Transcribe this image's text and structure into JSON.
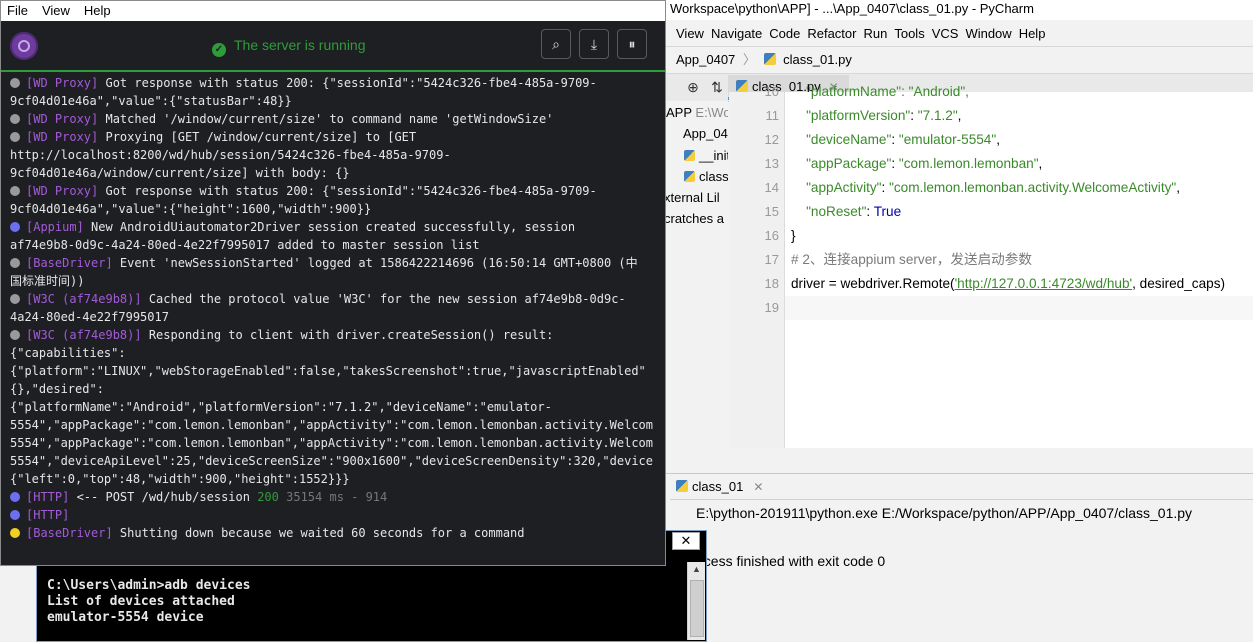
{
  "pycharm": {
    "title": "Workspace\\python\\APP] - ...\\App_0407\\class_01.py - PyCharm",
    "menu": [
      "View",
      "Navigate",
      "Code",
      "Refactor",
      "Run",
      "Tools",
      "VCS",
      "Window",
      "Help"
    ],
    "breadcrumb": [
      "App_0407",
      "class_01.py"
    ],
    "editor_tab": "class_01.py",
    "tree": [
      {
        "label": "APP",
        "extra": "E:\\Wo"
      },
      {
        "label": "App_04"
      },
      {
        "label": "__init"
      },
      {
        "label": "class"
      },
      {
        "label": "xternal Lil"
      },
      {
        "label": "cratches a"
      }
    ],
    "code_lines": [
      {
        "n": "10",
        "parts": [
          {
            "t": "    \"platformName\": \"Android\",",
            "c": "str"
          }
        ]
      },
      {
        "n": "11",
        "parts": [
          {
            "t": "    ",
            "c": ""
          },
          {
            "t": "\"platformVersion\"",
            "c": "str"
          },
          {
            "t": ": ",
            "c": ""
          },
          {
            "t": "\"7.1.2\"",
            "c": "str"
          },
          {
            "t": ",",
            "c": ""
          }
        ]
      },
      {
        "n": "12",
        "parts": [
          {
            "t": "    ",
            "c": ""
          },
          {
            "t": "\"deviceName\"",
            "c": "str"
          },
          {
            "t": ": ",
            "c": ""
          },
          {
            "t": "\"emulator-5554\"",
            "c": "str"
          },
          {
            "t": ",",
            "c": ""
          }
        ]
      },
      {
        "n": "13",
        "parts": [
          {
            "t": "    ",
            "c": ""
          },
          {
            "t": "\"appPackage\"",
            "c": "str"
          },
          {
            "t": ": ",
            "c": ""
          },
          {
            "t": "\"com.lemon.lemonban\"",
            "c": "str"
          },
          {
            "t": ",",
            "c": ""
          }
        ]
      },
      {
        "n": "14",
        "parts": [
          {
            "t": "    ",
            "c": ""
          },
          {
            "t": "\"appActivity\"",
            "c": "str"
          },
          {
            "t": ": ",
            "c": ""
          },
          {
            "t": "\"com.lemon.lemonban.activity.WelcomeActivity\"",
            "c": "str"
          },
          {
            "t": ",",
            "c": ""
          }
        ]
      },
      {
        "n": "15",
        "parts": [
          {
            "t": "    ",
            "c": ""
          },
          {
            "t": "\"noReset\"",
            "c": "str"
          },
          {
            "t": ": ",
            "c": ""
          },
          {
            "t": "True",
            "c": "kw"
          }
        ]
      },
      {
        "n": "16",
        "parts": [
          {
            "t": "}",
            "c": ""
          }
        ]
      },
      {
        "n": "17",
        "parts": [
          {
            "t": "# 2、连接appium server，发送启动参数",
            "c": "cmt"
          }
        ]
      },
      {
        "n": "18",
        "parts": [
          {
            "t": "driver = webdriver.Remote(",
            "c": ""
          },
          {
            "t": "'http://127.0.0.1:4723/wd/hub'",
            "c": "url"
          },
          {
            "t": ", desired_caps)",
            "c": ""
          }
        ]
      },
      {
        "n": "19",
        "parts": []
      }
    ],
    "run_tab": "class_01",
    "run_command": "E:\\python-201911\\python.exe E:/Workspace/python/APP/App_0407/class_01.py",
    "run_result": "ocess finished with exit code 0"
  },
  "cmd": {
    "lines": [
      "C:\\Users\\admin>adb devices",
      "List of devices attached",
      "emulator-5554   device"
    ],
    "close_label": "✕"
  },
  "appium": {
    "menu": [
      "File",
      "View",
      "Help"
    ],
    "status": "The server is running",
    "buttons": [
      {
        "name": "search-button",
        "icon": "search-icon",
        "glyph": "⌕"
      },
      {
        "name": "download-logs-button",
        "icon": "download-icon",
        "glyph": "⤓"
      },
      {
        "name": "pause-button",
        "icon": "pause-icon",
        "glyph": "⏸"
      }
    ],
    "log_lines": [
      {
        "lvl": "grey",
        "tag": "[WD Proxy]",
        "text": " Got response with status 200: {\"sessionId\":\"5424c326-fbe4-485a-9709-"
      },
      {
        "lvl": "",
        "tag": "",
        "text": "9cf04d01e46a\",\"value\":{\"statusBar\":48}}"
      },
      {
        "lvl": "grey",
        "tag": "[WD Proxy]",
        "text": " Matched '/window/current/size' to command name 'getWindowSize'"
      },
      {
        "lvl": "grey",
        "tag": "[WD Proxy]",
        "text": " Proxying [GET /window/current/size] to [GET"
      },
      {
        "lvl": "",
        "tag": "",
        "text": "http://localhost:8200/wd/hub/session/5424c326-fbe4-485a-9709-"
      },
      {
        "lvl": "",
        "tag": "",
        "text": "9cf04d01e46a/window/current/size] with body: {}"
      },
      {
        "lvl": "grey",
        "tag": "[WD Proxy]",
        "text": " Got response with status 200: {\"sessionId\":\"5424c326-fbe4-485a-9709-"
      },
      {
        "lvl": "",
        "tag": "",
        "text": "9cf04d01e46a\",\"value\":{\"height\":1600,\"width\":900}}"
      },
      {
        "lvl": "blue",
        "tag": "[Appium]",
        "text": " New AndroidUiautomator2Driver session created successfully, session"
      },
      {
        "lvl": "",
        "tag": "",
        "text": "af74e9b8-0d9c-4a24-80ed-4e22f7995017 added to master session list"
      },
      {
        "lvl": "grey",
        "tag": "[BaseDriver]",
        "text": " Event 'newSessionStarted' logged at 1586422214696 (16:50:14 GMT+0800 (中"
      },
      {
        "lvl": "",
        "tag": "",
        "text": "国标准时间))"
      },
      {
        "lvl": "grey",
        "tag": "[W3C (af74e9b8)]",
        "text": " Cached the protocol value 'W3C' for the new session af74e9b8-0d9c-"
      },
      {
        "lvl": "",
        "tag": "",
        "text": "4a24-80ed-4e22f7995017"
      },
      {
        "lvl": "grey",
        "tag": "[W3C (af74e9b8)]",
        "text": " Responding to client with driver.createSession() result:"
      },
      {
        "lvl": "",
        "tag": "",
        "text": "{\"capabilities\":"
      },
      {
        "lvl": "",
        "tag": "",
        "text": "{\"platform\":\"LINUX\",\"webStorageEnabled\":false,\"takesScreenshot\":true,\"javascriptEnabled\""
      },
      {
        "lvl": "",
        "tag": "",
        "text": "{},\"desired\":"
      },
      {
        "lvl": "",
        "tag": "",
        "text": "{\"platformName\":\"Android\",\"platformVersion\":\"7.1.2\",\"deviceName\":\"emulator-"
      },
      {
        "lvl": "",
        "tag": "",
        "text": "5554\",\"appPackage\":\"com.lemon.lemonban\",\"appActivity\":\"com.lemon.lemonban.activity.Welcom"
      },
      {
        "lvl": "",
        "tag": "",
        "text": "5554\",\"appPackage\":\"com.lemon.lemonban\",\"appActivity\":\"com.lemon.lemonban.activity.Welcom"
      },
      {
        "lvl": "",
        "tag": "",
        "text": "5554\",\"deviceApiLevel\":25,\"deviceScreenSize\":\"900x1600\",\"deviceScreenDensity\":320,\"device"
      },
      {
        "lvl": "",
        "tag": "",
        "text": "{\"left\":0,\"top\":48,\"width\":900,\"height\":1552}}}"
      },
      {
        "lvl": "blue",
        "tag": "[HTTP]",
        "text": " <-- POST /wd/hub/session ",
        "status": "200",
        "tail": " 35154 ms - 914"
      },
      {
        "lvl": "blue",
        "tag": "[HTTP]",
        "text": ""
      },
      {
        "lvl": "yellow",
        "tag": "[BaseDriver]",
        "text": " Shutting down because we waited 60 seconds for a command"
      }
    ]
  }
}
